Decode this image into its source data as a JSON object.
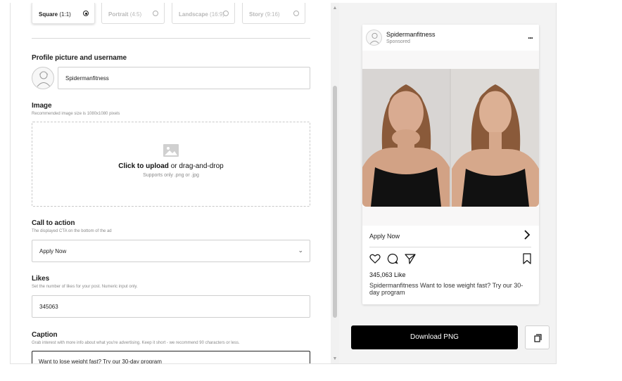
{
  "ratios": [
    {
      "label": "Square",
      "dim": "(1:1)",
      "selected": true
    },
    {
      "label": "Portrait",
      "dim": "(4:5)",
      "selected": false
    },
    {
      "label": "Landscape",
      "dim": "(16:9)",
      "selected": false
    },
    {
      "label": "Story",
      "dim": "(9:16)",
      "selected": false
    }
  ],
  "profile": {
    "label": "Profile picture and username",
    "username_value": "Spidermanfitness"
  },
  "image": {
    "label": "Image",
    "hint": "Recommended image size is 1080x1080 pixels",
    "upload_bold": "Click to upload",
    "upload_rest": " or drag-and-drop",
    "upload_hint": "Supports only .png or .jpg"
  },
  "cta": {
    "label": "Call to action",
    "hint": "The displayed CTA on the bottom of the ad",
    "value": "Apply Now"
  },
  "likes": {
    "label": "Likes",
    "hint": "Set the number of likes for your post. Numeric input only.",
    "value": "345063"
  },
  "caption": {
    "label": "Caption",
    "hint": "Grab interest with more info about what you're advertising. Keep it short - we recommend 90 characters or less.",
    "value": "Want to lose weight fast? Try our 30-day program"
  },
  "preview": {
    "username": "Spidermanfitness",
    "sponsored": "Sponsored",
    "more": "...",
    "cta_label": "Apply Now",
    "likes_text": "345,063 Like",
    "caption_user": "Spidermanfitness",
    "caption_text": " Want to lose weight fast? Try our 30-day program"
  },
  "actions": {
    "download_label": "Download PNG"
  },
  "colors": {
    "accent": "#000000",
    "panel_bg": "#f3f3f3"
  },
  "icons": [
    "image-placeholder-icon",
    "chevron-down-icon",
    "heart-icon",
    "comment-icon",
    "send-icon",
    "bookmark-icon",
    "chevron-right-icon",
    "copy-icon"
  ]
}
